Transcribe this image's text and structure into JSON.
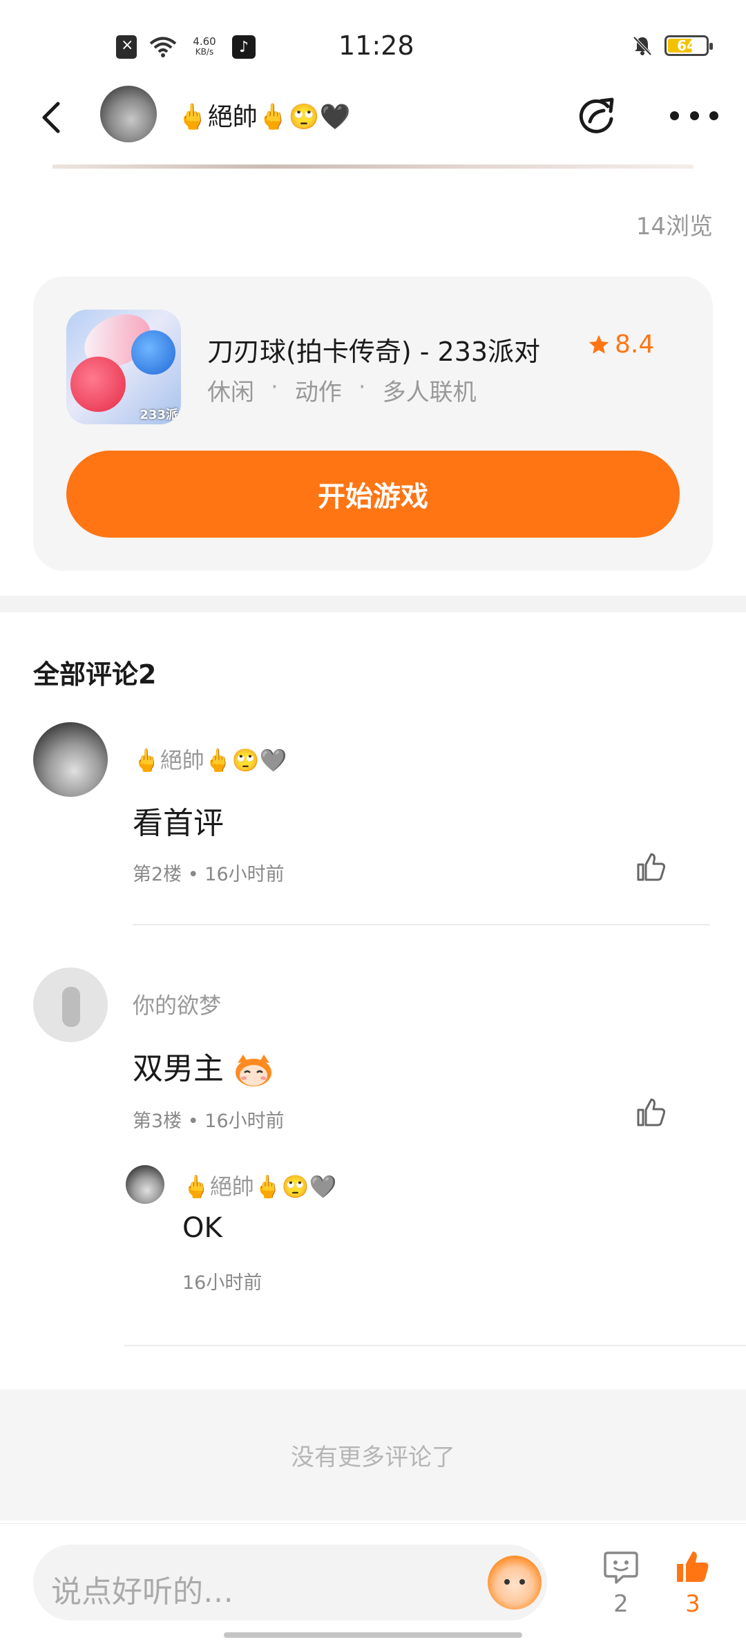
{
  "status_bar": {
    "speed_value": "4.60",
    "speed_unit": "KB/s",
    "time": "11:28",
    "battery": "64",
    "battery_level": 0.64
  },
  "header": {
    "user_name": "🖕絕帥🖕🙄🖤"
  },
  "post": {
    "views": "14浏览"
  },
  "game_card": {
    "title": "刀刃球(拍卡传奇) - 233派对",
    "rating": "8.4",
    "tags": [
      "休闲",
      "动作",
      "多人联机"
    ],
    "tag_separator": "·",
    "icon_badge": "233派",
    "start_button": "开始游戏"
  },
  "comments": {
    "title": "全部评论2",
    "items": [
      {
        "name": "🖕絕帥🖕🙄🩶",
        "text": "看首评",
        "meta": "第2楼 • 16小时前"
      },
      {
        "name": "你的欲梦",
        "text": "双男主",
        "meta": "第3楼 • 16小时前",
        "reply": {
          "name": "🖕絕帥🖕🙄🩶",
          "text": "OK",
          "time": "16小时前"
        }
      }
    ],
    "no_more": "没有更多评论了"
  },
  "bottom_bar": {
    "input_placeholder": "说点好听的…",
    "comment_count": "2",
    "like_count": "3",
    "accent_color": "#ff7514"
  }
}
